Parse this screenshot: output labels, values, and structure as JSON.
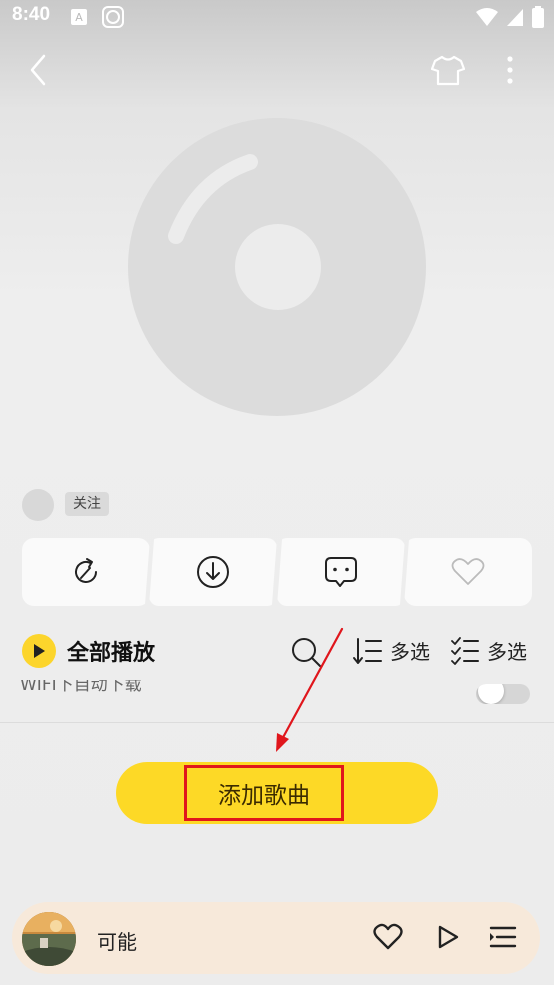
{
  "status_bar": {
    "time": "8:40"
  },
  "header": {
    "back_icon": "chevron-left-icon",
    "skin_icon": "tshirt-icon",
    "more_icon": "more-vertical-icon"
  },
  "author": {
    "follow_label": "关注"
  },
  "actions": [
    {
      "icon": "share-icon"
    },
    {
      "icon": "download-icon"
    },
    {
      "icon": "comment-icon"
    },
    {
      "icon": "heart-icon"
    }
  ],
  "list_header": {
    "play_all_label": "全部播放",
    "sort_label": "多选",
    "multiselect_label": "多选"
  },
  "wifi_auto_download": {
    "label": "WIFI下自动下载"
  },
  "add_songs": {
    "label": "添加歌曲"
  },
  "mini_player": {
    "song_title": "可能"
  },
  "colors": {
    "accent": "#fdd926",
    "highlight_border": "#e0161c",
    "player_bg": "#f7e9da"
  }
}
